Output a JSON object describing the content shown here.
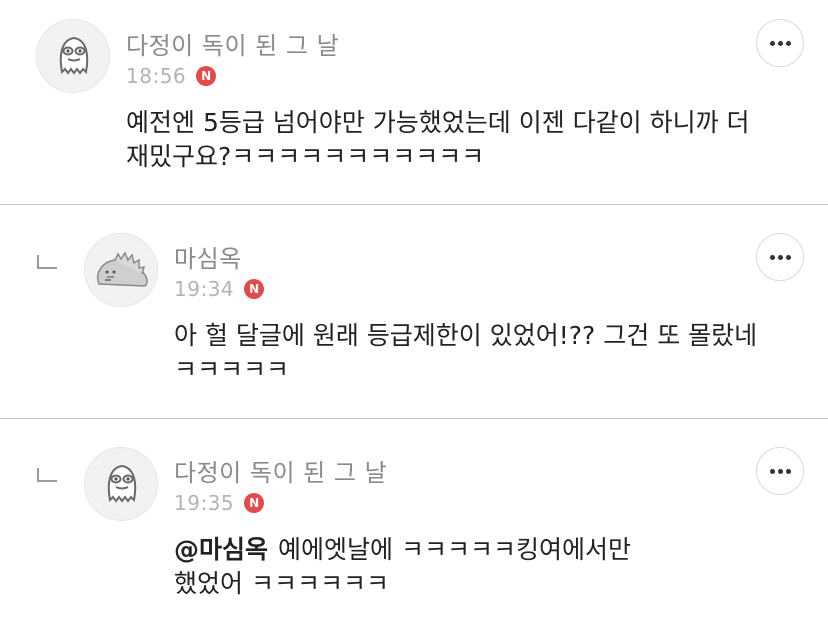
{
  "comments": [
    {
      "nickname": "다정이 독이 된 그 날",
      "time": "18:56",
      "badge": "N",
      "mention": "",
      "line1": "예전엔 5등급 넘어야만 가능했었는데 이젠 다같이 하니까 더",
      "line2": "재밌구요?ㅋㅋㅋㅋㅋㅋㅋㅋㅋㅋㅋ",
      "avatar_icon": "ghost-character-icon",
      "is_reply": false
    },
    {
      "nickname": "마심옥",
      "time": "19:34",
      "badge": "N",
      "mention": "",
      "line1": "아 헐 달글에 원래 등급제한이 있었어!?? 그건 또 몰랐네",
      "line2": "ㅋㅋㅋㅋㅋ",
      "avatar_icon": "dinosaur-character-icon",
      "is_reply": true
    },
    {
      "nickname": "다정이 독이 된 그 날",
      "time": "19:35",
      "badge": "N",
      "mention": "@마심옥",
      "line1": "예에엣날에 ㅋㅋㅋㅋㅋ킹여에서만",
      "line2": "했었어 ㅋㅋㅋㅋㅋㅋ",
      "avatar_icon": "ghost-character-icon",
      "is_reply": true
    }
  ],
  "colors": {
    "badge": "#e34b4b",
    "nickname": "#8a8a8a",
    "time": "#b3b3b3",
    "divider": "#c8c8c8"
  }
}
